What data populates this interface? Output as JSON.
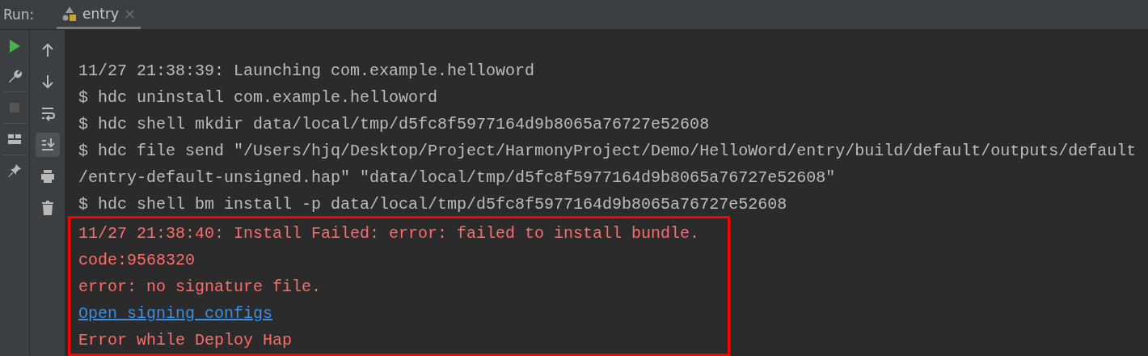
{
  "run_bar": {
    "label": "Run:",
    "tab": {
      "title": "entry",
      "close": "×"
    }
  },
  "left_toolbar": [
    {
      "kind": "run",
      "disabled": false
    },
    {
      "kind": "wrench",
      "disabled": false
    },
    {
      "kind": "stop",
      "disabled": true
    },
    {
      "kind": "layout",
      "disabled": false
    },
    {
      "kind": "pin",
      "disabled": false
    }
  ],
  "right_toolbar": [
    {
      "kind": "up",
      "on": false
    },
    {
      "kind": "down",
      "on": false
    },
    {
      "kind": "wrap",
      "on": false
    },
    {
      "kind": "scroll_end",
      "on": true
    },
    {
      "kind": "print",
      "on": false
    },
    {
      "kind": "trash",
      "on": false
    }
  ],
  "console": {
    "lines": [
      "11/27 21:38:39: Launching com.example.helloword",
      "$ hdc uninstall com.example.helloword",
      "$ hdc shell mkdir data/local/tmp/d5fc8f5977164d9b8065a76727e52608",
      "$ hdc file send \"/Users/hjq/Desktop/Project/HarmonyProject/Demo/HelloWord/entry/build/default/outputs/default",
      "/entry-default-unsigned.hap\" \"data/local/tmp/d5fc8f5977164d9b8065a76727e52608\"",
      "$ hdc shell bm install -p data/local/tmp/d5fc8f5977164d9b8065a76727e52608"
    ],
    "highlighted_lines": [
      {
        "kind": "error",
        "text": "11/27 21:38:40: Install Failed: error: failed to install bundle."
      },
      {
        "kind": "error",
        "text": "code:9568320"
      },
      {
        "kind": "error",
        "text": "error: no signature file."
      },
      {
        "kind": "link",
        "text": "Open signing configs"
      },
      {
        "kind": "error",
        "text": "Error while Deploy Hap"
      }
    ]
  }
}
